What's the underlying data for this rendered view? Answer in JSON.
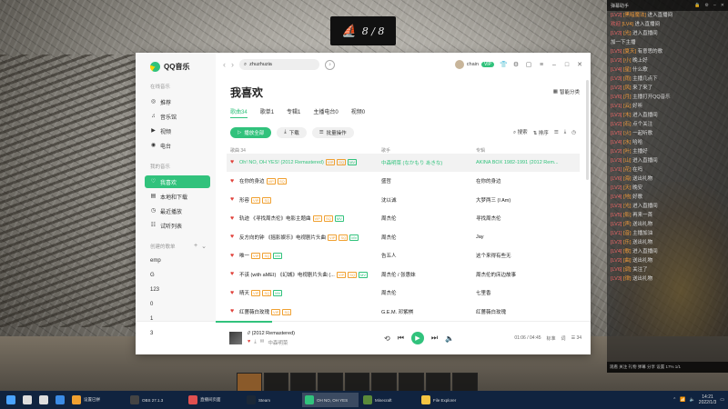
{
  "counter": {
    "text": "8 / 8"
  },
  "app": {
    "name": "QQ音乐"
  },
  "sidebar": {
    "section_online": "在线音乐",
    "online_items": [
      {
        "label": "推荐",
        "icon": "recommend-icon"
      },
      {
        "label": "音乐馆",
        "icon": "music-hall-icon"
      },
      {
        "label": "视频",
        "icon": "video-icon"
      },
      {
        "label": "电台",
        "icon": "radio-icon"
      }
    ],
    "section_mine": "我的音乐",
    "mine_items": [
      {
        "label": "我喜欢",
        "icon": "heart-icon",
        "active": true
      },
      {
        "label": "本地和下载",
        "icon": "local-download-icon"
      },
      {
        "label": "最近播放",
        "icon": "recent-icon"
      },
      {
        "label": "试听列表",
        "icon": "trial-list-icon"
      }
    ],
    "section_created": "创建的歌单",
    "playlists": [
      "emp",
      "G",
      "123",
      "0",
      "1",
      "3"
    ]
  },
  "topbar": {
    "search_value": "zhuzhuzia",
    "user_name": "chain",
    "vip_label": "VIP"
  },
  "page": {
    "title": "我喜欢",
    "smart_label": "智能分类",
    "tabs": [
      "歌曲34",
      "歌单1",
      "专辑1",
      "主播电台0",
      "视频0"
    ],
    "actions": {
      "play_all": "播放全部",
      "download": "下载",
      "batch": "批量操作"
    },
    "right_actions": {
      "search": "搜索",
      "sort": "排序"
    },
    "columns": [
      "歌曲 34",
      "歌手",
      "专辑"
    ]
  },
  "songs": [
    {
      "title": "Oh! NO, OH YES! (2012 Remastered)",
      "artist": "中森明菜 (なかもり あきな)",
      "album": "AKINA BOX 1982-1991 (2012 Rem...",
      "tags": [
        "VIP",
        "SQ",
        "MV"
      ],
      "highlight": true
    },
    {
      "title": "在你的身边",
      "artist": "盛哲",
      "album": "在你的身边",
      "tags": [
        "VIP",
        "SQ"
      ]
    },
    {
      "title": "形容",
      "artist": "沈以诚",
      "album": "大梦两三 (I Am)",
      "tags": [
        "VIP",
        "SQ"
      ]
    },
    {
      "title": "轨迹 《寻找周杰伦》电影主题曲",
      "artist": "周杰伦",
      "album": "寻找周杰伦",
      "tags": [
        "VIP",
        "SQ",
        "MV"
      ]
    },
    {
      "title": "反方向的钟 《摇影娱乐》电视剧片头曲",
      "artist": "周杰伦",
      "album": "Jay",
      "tags": [
        "VIP",
        "SQ",
        "MV"
      ]
    },
    {
      "title": "唯一",
      "artist": "告五人",
      "album": "这个来得有些无",
      "tags": [
        "VIP",
        "SQ",
        "MV"
      ]
    },
    {
      "title": "不该 (with aMEI) 《幻城》电视剧片头曲 (...",
      "artist": "周杰伦 / 张惠妹",
      "album": "周杰伦的床边故事",
      "tags": [
        "VIP",
        "SQ",
        "MV"
      ]
    },
    {
      "title": "晴天",
      "artist": "周杰伦",
      "album": "七里香",
      "tags": [
        "VIP",
        "SQ",
        "MV"
      ]
    },
    {
      "title": "红蔷薇白玫瑰",
      "artist": "G.E.M. 邓紫棋",
      "album": "红蔷薇白玫瑰",
      "tags": [
        "VIP",
        "SQ"
      ]
    }
  ],
  "player": {
    "title": "// (2012 Remastered)",
    "sub": "中森明菜",
    "time": "01:06 / 04:45",
    "quality": "标准",
    "count": "34"
  },
  "chat": {
    "header": "弹幕助手",
    "messages": [
      {
        "lv": "[LV2]",
        "name": "[黑暗魔法]",
        "text": "进入直播间"
      },
      {
        "lv": "欢迎",
        "name": "[LV4]",
        "text": "进入直播间"
      },
      {
        "lv": "[LV3]",
        "name": "[光]",
        "text": "进入直播间"
      },
      {
        "lv": "",
        "name": "",
        "text": "加一下主播"
      },
      {
        "lv": "[LV5]",
        "name": "[夏天]",
        "text": "有意思的歌"
      },
      {
        "lv": "[LV2]",
        "name": "[小]",
        "text": "晚上好"
      },
      {
        "lv": "[LV4]",
        "name": "[星]",
        "text": "什么歌"
      },
      {
        "lv": "[LV3]",
        "name": "[雨]",
        "text": "主播几点下"
      },
      {
        "lv": "[LV2]",
        "name": "[风]",
        "text": "来了来了"
      },
      {
        "lv": "[LV6]",
        "name": "[月]",
        "text": "主播打开QQ音乐"
      },
      {
        "lv": "[LV1]",
        "name": "[云]",
        "text": "好听"
      },
      {
        "lv": "[LV3]",
        "name": "[木]",
        "text": "进入直播间"
      },
      {
        "lv": "[LV2]",
        "name": "[石]",
        "text": "点个关注"
      },
      {
        "lv": "[LV5]",
        "name": "[火]",
        "text": "一起听歌"
      },
      {
        "lv": "[LV4]",
        "name": "[水]",
        "text": "哈哈"
      },
      {
        "lv": "[LV2]",
        "name": "[叶]",
        "text": "主播好"
      },
      {
        "lv": "[LV3]",
        "name": "[山]",
        "text": "进入直播间"
      },
      {
        "lv": "[LV1]",
        "name": "[花]",
        "text": "在吗"
      },
      {
        "lv": "[LV6]",
        "name": "[海]",
        "text": "送出礼物"
      },
      {
        "lv": "[LV2]",
        "name": "[天]",
        "text": "晚安"
      },
      {
        "lv": "[LV4]",
        "name": "[地]",
        "text": "好歌"
      },
      {
        "lv": "[LV3]",
        "name": "[光]",
        "text": "进入直播间"
      },
      {
        "lv": "[LV5]",
        "name": "[影]",
        "text": "再来一首"
      },
      {
        "lv": "[LV2]",
        "name": "[声]",
        "text": "送出礼物"
      },
      {
        "lv": "[LV1]",
        "name": "[音]",
        "text": "主播加油"
      },
      {
        "lv": "[LV3]",
        "name": "[乐]",
        "text": "送出礼物"
      },
      {
        "lv": "[LV4]",
        "name": "[歌]",
        "text": "进入直播间"
      },
      {
        "lv": "[LV2]",
        "name": "[曲]",
        "text": "送出礼物"
      },
      {
        "lv": "[LV6]",
        "name": "[调]",
        "text": "关注了"
      },
      {
        "lv": "[LV3]",
        "name": "[律]",
        "text": "送出礼物"
      }
    ],
    "footer": "观看 关注 礼物 弹幕 分享 设置 17% 1/1"
  },
  "taskbar": {
    "items": [
      {
        "label": "",
        "icon": "windows-icon",
        "color": "#4aa3ff"
      },
      {
        "label": "",
        "icon": "search-icon",
        "color": "#dddddd"
      },
      {
        "label": "",
        "icon": "taskview-icon",
        "color": "#dddddd"
      },
      {
        "label": "",
        "icon": "browser-icon",
        "color": "#3b8be5"
      },
      {
        "label": "设置已拼",
        "icon": "app-icon",
        "color": "#f0a030"
      },
      {
        "label": "OBS 27.1.3",
        "icon": "obs-icon",
        "color": "#444444"
      },
      {
        "label": "直播间页面",
        "icon": "live-icon",
        "color": "#e05050"
      },
      {
        "label": "Steam",
        "icon": "steam-icon",
        "color": "#1b2838"
      },
      {
        "label": "OH NO, OH YES",
        "icon": "qqmusic-icon",
        "color": "#31c27c",
        "active": true
      },
      {
        "label": "Minecraft",
        "icon": "minecraft-icon",
        "color": "#5a8a3a"
      },
      {
        "label": "File Explorer",
        "icon": "explorer-icon",
        "color": "#f5c542"
      }
    ],
    "time": "14:21",
    "date": "2022/1/3"
  },
  "colors": {
    "accent": "#31c27c",
    "heart": "#e0413a",
    "tag_quality": "#f0a030"
  }
}
